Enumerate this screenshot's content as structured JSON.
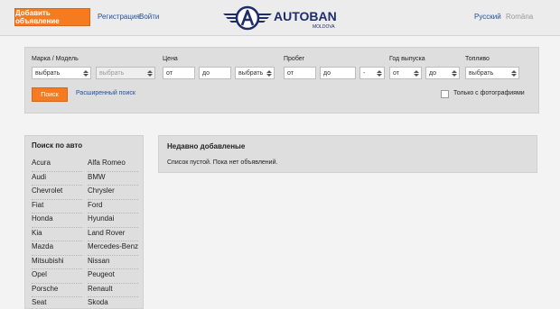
{
  "header": {
    "add_ad_label": "Добавить объявление",
    "register_label": "Регистрация",
    "login_label": "Войти",
    "logo_text": "AUTOBAN",
    "logo_sub": "MOLDOVA",
    "lang_active": "Русский",
    "lang_other": "Romāna"
  },
  "search": {
    "make_model_label": "Марка / Модель",
    "make_select": "выбрать",
    "model_select": "выбрать",
    "price_label": "Цена",
    "price_from": "от",
    "price_to": "до",
    "price_currency": "выбрать",
    "mileage_label": "Пробег",
    "mileage_from": "от",
    "mileage_to": "до",
    "mileage_unit": "-",
    "year_label": "Год выпуска",
    "year_from": "от",
    "year_to": "до",
    "fuel_label": "Топливо",
    "fuel_select": "выбрать",
    "search_button": "Поиск",
    "advanced_link": "Расширенный поиск",
    "photos_only_label": "Только с фотографиями"
  },
  "brands": {
    "title": "Поиск по авто",
    "col1": [
      "Acura",
      "Audi",
      "Chevrolet",
      "Fiat",
      "Honda",
      "Kia",
      "Mazda",
      "Mitsubishi",
      "Opel",
      "Porsche",
      "Seat"
    ],
    "col2": [
      "Alfa Romeo",
      "BMW",
      "Chrysler",
      "Ford",
      "Hyundai",
      "Land Rover",
      "Mercedes-Benz",
      "Nissan",
      "Peugeot",
      "Renault",
      "Skoda"
    ]
  },
  "recent": {
    "title": "Недавно добавленые",
    "empty_text": "Список пустой. Пока нет объявлений."
  },
  "colors": {
    "accent": "#f47b20",
    "link": "#1f4e9c",
    "logo": "#1d2c6b"
  }
}
